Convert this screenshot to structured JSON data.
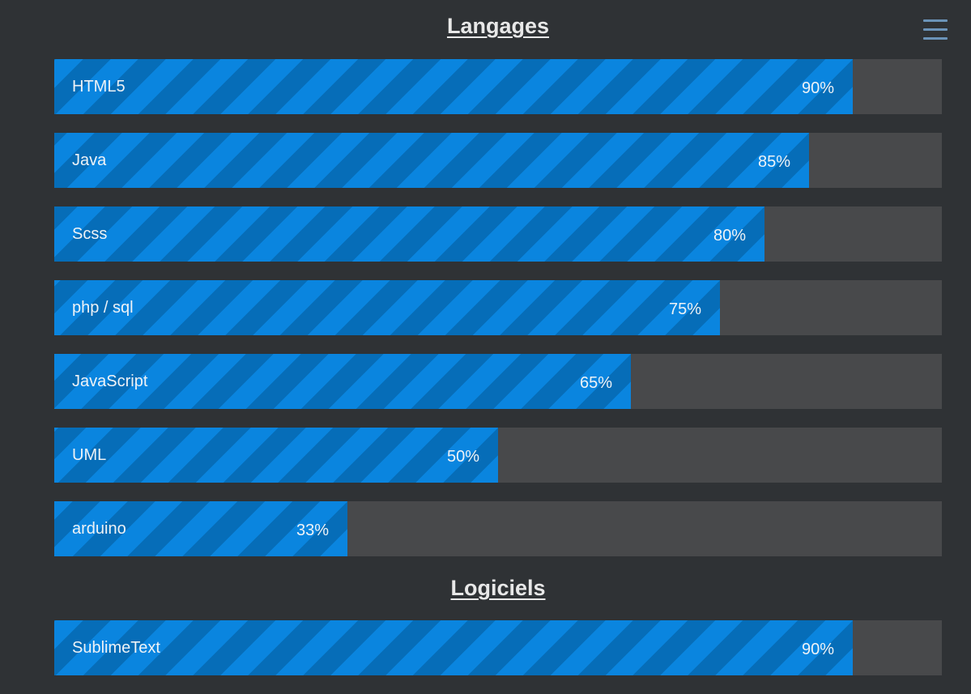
{
  "menu": {
    "icon": "hamburger-menu-icon"
  },
  "colors": {
    "background": "#2f3235",
    "bar_track": "#48494b",
    "bar_fill": "#0a85df",
    "bar_stripe": "#066db8",
    "menu_icon": "#6b93b8"
  },
  "sections": [
    {
      "title": "Langages",
      "skills": [
        {
          "name": "HTML5",
          "percent_label": "90%",
          "level": 0.9
        },
        {
          "name": "Java",
          "percent_label": "85%",
          "level": 0.85
        },
        {
          "name": "Scss",
          "percent_label": "80%",
          "level": 0.8
        },
        {
          "name": "php / sql",
          "percent_label": "75%",
          "level": 0.75
        },
        {
          "name": "JavaScript",
          "percent_label": "65%",
          "level": 0.65
        },
        {
          "name": "UML",
          "percent_label": "50%",
          "level": 0.5
        },
        {
          "name": "arduino",
          "percent_label": "33%",
          "level": 0.33
        }
      ]
    },
    {
      "title": "Logiciels",
      "skills": [
        {
          "name": "SublimeText",
          "percent_label": "90%",
          "level": 0.9
        }
      ]
    }
  ]
}
